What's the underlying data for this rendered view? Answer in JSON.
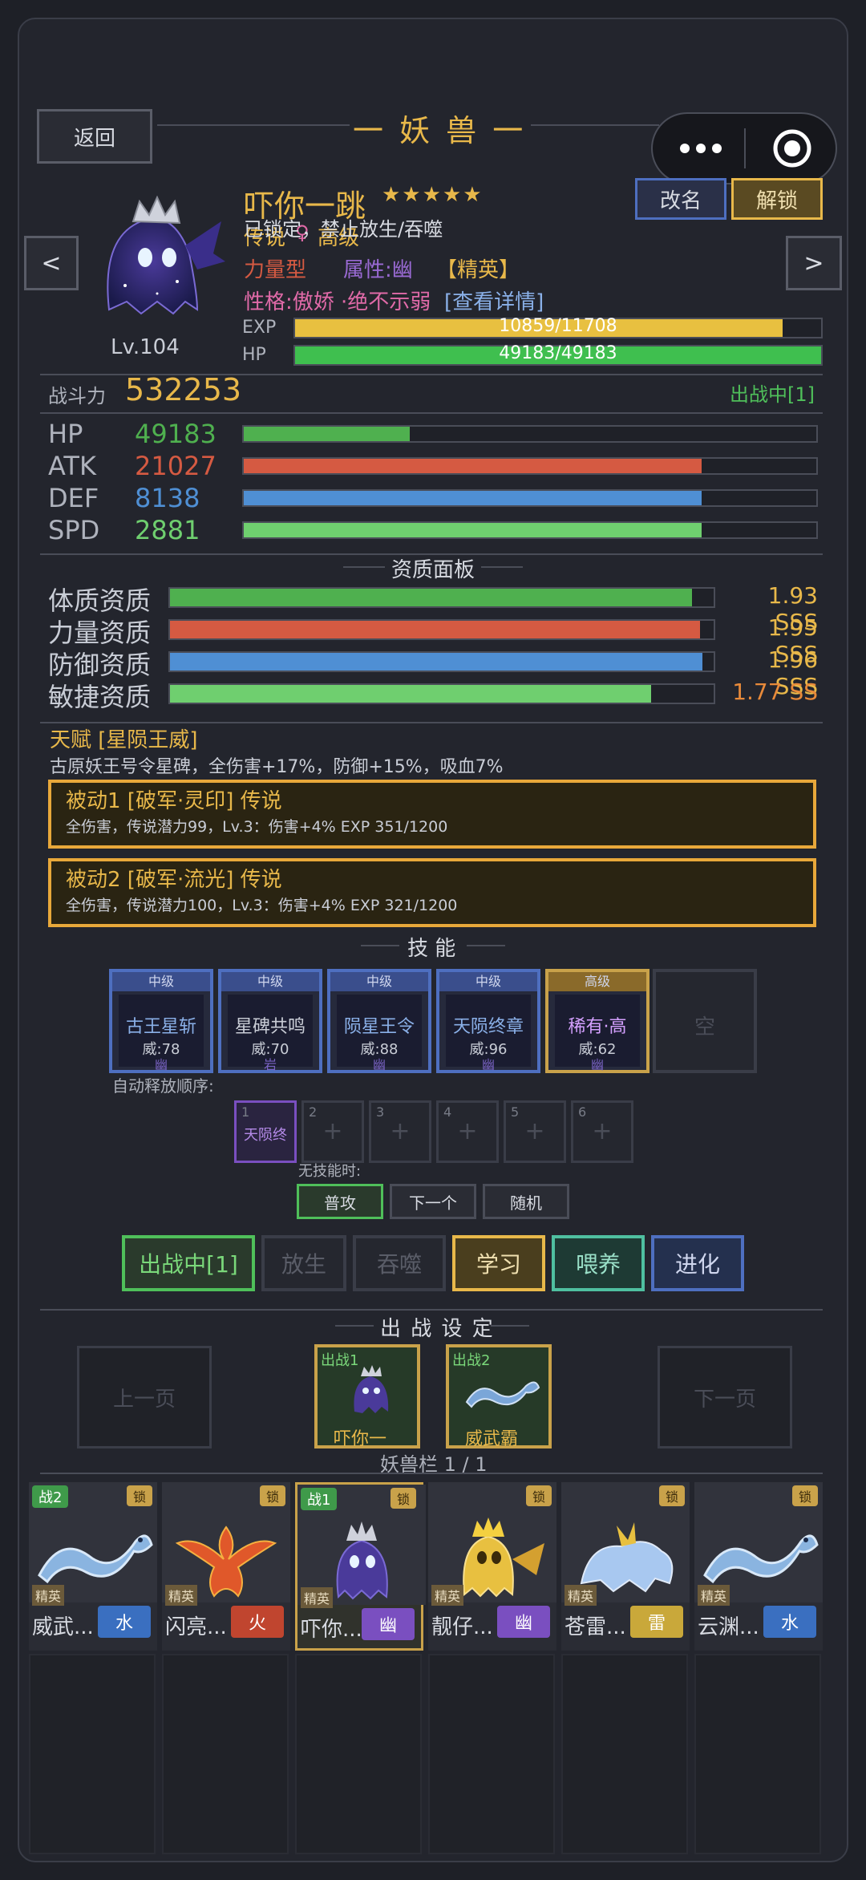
{
  "header": {
    "title": "一 妖 兽 一",
    "back_label": "返回"
  },
  "pet": {
    "name": "吓你一跳",
    "stars": "★★★★★",
    "overlay_text": "已锁定，禁止放生/吞噬",
    "rarity": "传说",
    "gender": "♀",
    "grade": "高级",
    "type": "力量型",
    "attribute": "属性:幽",
    "rank": "【精英】",
    "personality": "性格:傲娇 ·绝不示弱",
    "detail_link": "[查看详情]",
    "level": "Lv.104",
    "exp_label": "EXP",
    "exp_text": "10859/11708",
    "exp_value": 10859,
    "exp_max": 11708,
    "hp_label": "HP",
    "hp_text": "49183/49183",
    "hp_value": 49183,
    "hp_max": 49183
  },
  "buttons": {
    "rename": "改名",
    "unlock": "解锁",
    "prev": "<",
    "next": ">"
  },
  "power": {
    "label": "战斗力",
    "value": "532253",
    "status": "出战中[1]"
  },
  "stats": [
    {
      "label": "HP",
      "value": "49183",
      "fill": 0.29,
      "color": "#4fb04f"
    },
    {
      "label": "ATK",
      "value": "21027",
      "fill": 0.8,
      "color": "#d55a42"
    },
    {
      "label": "DEF",
      "value": "8138",
      "fill": 0.8,
      "color": "#4f8fd4"
    },
    {
      "label": "SPD",
      "value": "2881",
      "fill": 0.8,
      "color": "#6fcf6f"
    }
  ],
  "aptitude": {
    "title": "资质面板",
    "items": [
      {
        "label": "体质资质",
        "value": "1.93 SSS",
        "fill": 0.96,
        "color": "#4fb04f",
        "value_color": "#e8b84a"
      },
      {
        "label": "力量资质",
        "value": "1.95 SSS",
        "fill": 0.975,
        "color": "#d55a42",
        "value_color": "#e8b84a"
      },
      {
        "label": "防御资质",
        "value": "1.96 SSS",
        "fill": 0.98,
        "color": "#4f8fd4",
        "value_color": "#e8b84a"
      },
      {
        "label": "敏捷资质",
        "value": "1.77 SS",
        "fill": 0.885,
        "color": "#6fcf6f",
        "value_color": "#e88a3a"
      }
    ]
  },
  "talent": {
    "title": "天赋 [星陨王威]",
    "desc": "古原妖王号令星碑，全伤害+17%，防御+15%，吸血7%"
  },
  "passives": [
    {
      "title": "被动1 [破军·灵印] 传说",
      "desc": "全伤害，传说潜力99，Lv.3：伤害+4% EXP 351/1200"
    },
    {
      "title": "被动2 [破军·流光] 传说",
      "desc": "全伤害，传说潜力100，Lv.3：伤害+4% EXP 321/1200"
    }
  ],
  "skills": {
    "title": "技 能",
    "cards": [
      {
        "tier": "中级",
        "name": "古王星斩",
        "power": "威:78",
        "element": "幽"
      },
      {
        "tier": "中级",
        "name": "星碑共鸣",
        "power": "威:70",
        "element": "岩"
      },
      {
        "tier": "中级",
        "name": "陨星王令",
        "power": "威:88",
        "element": "幽"
      },
      {
        "tier": "中级",
        "name": "天陨终章",
        "power": "威:96",
        "element": "幽"
      },
      {
        "tier": "高级",
        "name": "稀有·高",
        "power": "威:62",
        "element": "幽"
      }
    ],
    "empty": "空",
    "auto_order_label": "自动释放顺序:",
    "slots": [
      {
        "n": "1",
        "label": "天陨终"
      },
      {
        "n": "2",
        "label": "+"
      },
      {
        "n": "3",
        "label": "+"
      },
      {
        "n": "4",
        "label": "+"
      },
      {
        "n": "5",
        "label": "+"
      },
      {
        "n": "6",
        "label": "+"
      }
    ],
    "no_skill_label": "无技能时:",
    "no_skill_options": [
      "普攻",
      "下一个",
      "随机"
    ]
  },
  "actions": [
    "出战中[1]",
    "放生",
    "吞噬",
    "学习",
    "喂养",
    "进化"
  ],
  "battle": {
    "title": "出 战 设 定",
    "prev_page": "上一页",
    "next_page": "下一页",
    "slot1_label": "出战1",
    "slot1_name": "吓你一",
    "slot2_label": "出战2",
    "slot2_name": "威武霸",
    "roster_label": "妖兽栏 1 / 1"
  },
  "roster": [
    {
      "name": "威武...",
      "element": "水",
      "el_color": "#3a6fc0",
      "battle": "战2",
      "lock": "锁",
      "tag": "精英"
    },
    {
      "name": "闪亮...",
      "element": "火",
      "el_color": "#c0452f",
      "battle": "",
      "lock": "锁",
      "tag": "精英"
    },
    {
      "name": "吓你...",
      "element": "幽",
      "el_color": "#7a4fc0",
      "battle": "战1",
      "lock": "锁",
      "tag": "精英"
    },
    {
      "name": "靓仔...",
      "element": "幽",
      "el_color": "#7a4fc0",
      "battle": "",
      "lock": "锁",
      "tag": "精英"
    },
    {
      "name": "苍雷...",
      "element": "雷",
      "el_color": "#c9a83a",
      "battle": "",
      "lock": "锁",
      "tag": "精英"
    },
    {
      "name": "云渊...",
      "element": "水",
      "el_color": "#3a6fc0",
      "battle": "",
      "lock": "锁",
      "tag": "精英"
    }
  ]
}
